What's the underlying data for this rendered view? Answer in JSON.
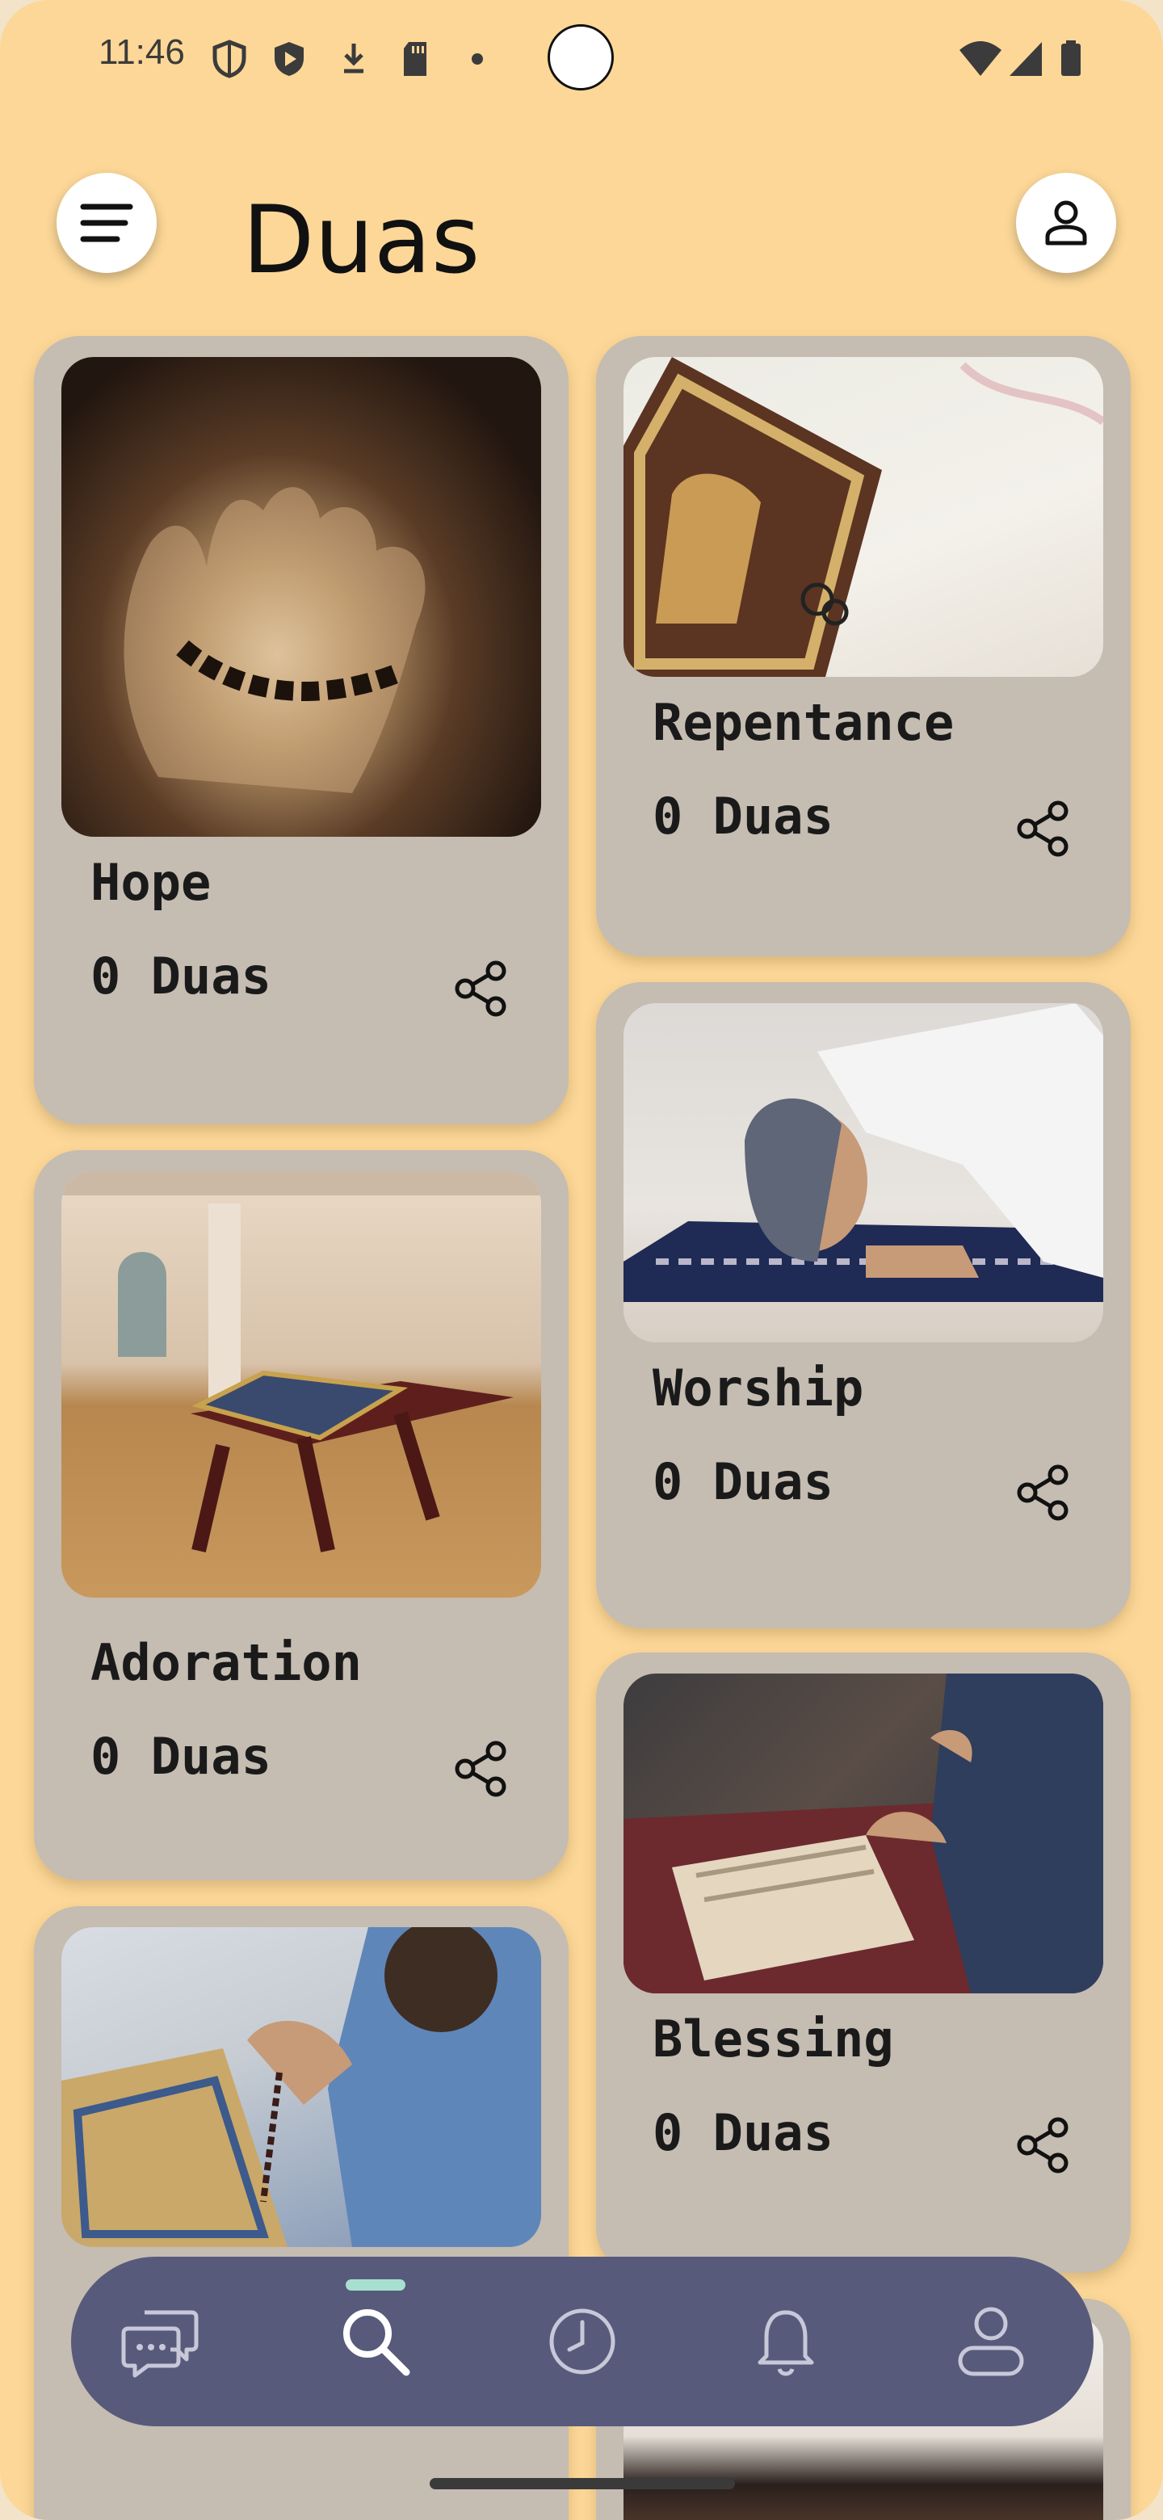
{
  "status_bar": {
    "time": "11:46"
  },
  "header": {
    "title": "Duas"
  },
  "cards": [
    {
      "name": "Hope",
      "count": "0 Duas"
    },
    {
      "name": "Repentance",
      "count": "0 Duas"
    },
    {
      "name": "Worship",
      "count": "0 Duas"
    },
    {
      "name": "Adoration",
      "count": "0 Duas"
    },
    {
      "name": "Blessing",
      "count": "0 Duas"
    }
  ],
  "bottom_nav": {
    "items": [
      "chat-icon",
      "search-icon",
      "clock-icon",
      "bell-icon",
      "profile-icon"
    ],
    "active": "search-icon"
  },
  "colors": {
    "background": "#fcd797",
    "card": "#c5bcb2",
    "nav": "#585a7c",
    "nav_indicator": "#a8e0cf"
  }
}
